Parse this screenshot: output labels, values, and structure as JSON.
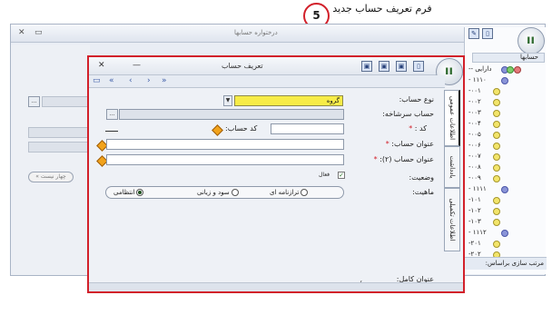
{
  "annotation": {
    "number": "5",
    "text": "فرم تعریف حساب جدید"
  },
  "background_window": {
    "title": "درختواره حسابها",
    "minimize": "▭",
    "close": "✕",
    "pill_text": "« چهار نیست"
  },
  "tree": {
    "tab_label": "حسابها",
    "rows": [
      {
        "code": "-- دارایی"
      },
      {
        "code": "- ۱۱۱۰"
      },
      {
        "code": "-۰۰۱"
      },
      {
        "code": "-۰۰۲"
      },
      {
        "code": "-۰۰۳"
      },
      {
        "code": "-۰۰۴"
      },
      {
        "code": "-۰۰۵"
      },
      {
        "code": "-۰۰۶"
      },
      {
        "code": "-۰۰۷"
      },
      {
        "code": "-۰۰۸"
      },
      {
        "code": "-۰۰۹"
      },
      {
        "code": "- ۱۱۱۱"
      },
      {
        "code": "-۱۰۱"
      },
      {
        "code": "-۱۰۲"
      },
      {
        "code": "-۱۰۳"
      },
      {
        "code": "- ۱۱۱۲"
      },
      {
        "code": "-۲۰۱"
      },
      {
        "code": "-۲۰۲"
      },
      {
        "code": "-۲۰۳"
      }
    ],
    "sort_label": "مرتب سازی براساس:"
  },
  "dialog": {
    "title": "تعریف حساب",
    "minimize": "—",
    "close": "✕",
    "nav": {
      "first": "«",
      "prev": "‹",
      "next": "›",
      "last": "»"
    },
    "side_tabs": {
      "general": "اطلاعات عمومی",
      "notes": "یادداشت",
      "extra": "اطلاعات تکمیلی"
    },
    "labels": {
      "account_type": "نوع حساب:",
      "parent_account": "حساب سرشاخه:",
      "code": "کد :",
      "account_code": "کد حساب:",
      "account_title": "عنوان حساب:",
      "account_title2": "عنوان حساب (۲):",
      "status": "وضعیت:",
      "active": "فعال",
      "nature": "ماهیت:",
      "full_title": "عنوان کامل:"
    },
    "values": {
      "account_type": "گروه",
      "full_title": "/"
    },
    "nature_options": {
      "balance": "ترازنامه ای",
      "profit_loss": "سود و زیانی",
      "disciplinary": "انتظامی"
    },
    "required_mark": "*"
  }
}
